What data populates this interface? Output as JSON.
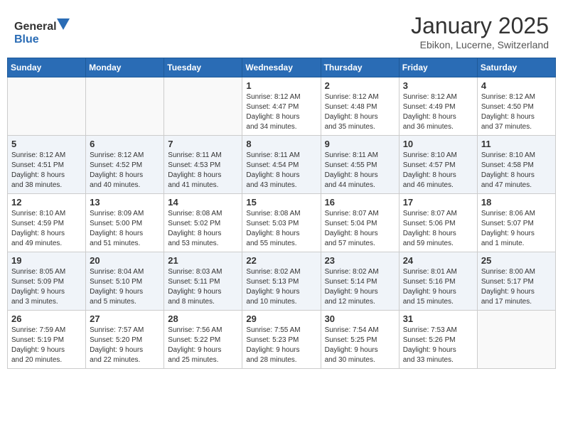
{
  "header": {
    "logo_general": "General",
    "logo_blue": "Blue",
    "month": "January 2025",
    "location": "Ebikon, Lucerne, Switzerland"
  },
  "days_of_week": [
    "Sunday",
    "Monday",
    "Tuesday",
    "Wednesday",
    "Thursday",
    "Friday",
    "Saturday"
  ],
  "weeks": [
    [
      {
        "day": "",
        "info": ""
      },
      {
        "day": "",
        "info": ""
      },
      {
        "day": "",
        "info": ""
      },
      {
        "day": "1",
        "info": "Sunrise: 8:12 AM\nSunset: 4:47 PM\nDaylight: 8 hours\nand 34 minutes."
      },
      {
        "day": "2",
        "info": "Sunrise: 8:12 AM\nSunset: 4:48 PM\nDaylight: 8 hours\nand 35 minutes."
      },
      {
        "day": "3",
        "info": "Sunrise: 8:12 AM\nSunset: 4:49 PM\nDaylight: 8 hours\nand 36 minutes."
      },
      {
        "day": "4",
        "info": "Sunrise: 8:12 AM\nSunset: 4:50 PM\nDaylight: 8 hours\nand 37 minutes."
      }
    ],
    [
      {
        "day": "5",
        "info": "Sunrise: 8:12 AM\nSunset: 4:51 PM\nDaylight: 8 hours\nand 38 minutes."
      },
      {
        "day": "6",
        "info": "Sunrise: 8:12 AM\nSunset: 4:52 PM\nDaylight: 8 hours\nand 40 minutes."
      },
      {
        "day": "7",
        "info": "Sunrise: 8:11 AM\nSunset: 4:53 PM\nDaylight: 8 hours\nand 41 minutes."
      },
      {
        "day": "8",
        "info": "Sunrise: 8:11 AM\nSunset: 4:54 PM\nDaylight: 8 hours\nand 43 minutes."
      },
      {
        "day": "9",
        "info": "Sunrise: 8:11 AM\nSunset: 4:55 PM\nDaylight: 8 hours\nand 44 minutes."
      },
      {
        "day": "10",
        "info": "Sunrise: 8:10 AM\nSunset: 4:57 PM\nDaylight: 8 hours\nand 46 minutes."
      },
      {
        "day": "11",
        "info": "Sunrise: 8:10 AM\nSunset: 4:58 PM\nDaylight: 8 hours\nand 47 minutes."
      }
    ],
    [
      {
        "day": "12",
        "info": "Sunrise: 8:10 AM\nSunset: 4:59 PM\nDaylight: 8 hours\nand 49 minutes."
      },
      {
        "day": "13",
        "info": "Sunrise: 8:09 AM\nSunset: 5:00 PM\nDaylight: 8 hours\nand 51 minutes."
      },
      {
        "day": "14",
        "info": "Sunrise: 8:08 AM\nSunset: 5:02 PM\nDaylight: 8 hours\nand 53 minutes."
      },
      {
        "day": "15",
        "info": "Sunrise: 8:08 AM\nSunset: 5:03 PM\nDaylight: 8 hours\nand 55 minutes."
      },
      {
        "day": "16",
        "info": "Sunrise: 8:07 AM\nSunset: 5:04 PM\nDaylight: 8 hours\nand 57 minutes."
      },
      {
        "day": "17",
        "info": "Sunrise: 8:07 AM\nSunset: 5:06 PM\nDaylight: 8 hours\nand 59 minutes."
      },
      {
        "day": "18",
        "info": "Sunrise: 8:06 AM\nSunset: 5:07 PM\nDaylight: 9 hours\nand 1 minute."
      }
    ],
    [
      {
        "day": "19",
        "info": "Sunrise: 8:05 AM\nSunset: 5:09 PM\nDaylight: 9 hours\nand 3 minutes."
      },
      {
        "day": "20",
        "info": "Sunrise: 8:04 AM\nSunset: 5:10 PM\nDaylight: 9 hours\nand 5 minutes."
      },
      {
        "day": "21",
        "info": "Sunrise: 8:03 AM\nSunset: 5:11 PM\nDaylight: 9 hours\nand 8 minutes."
      },
      {
        "day": "22",
        "info": "Sunrise: 8:02 AM\nSunset: 5:13 PM\nDaylight: 9 hours\nand 10 minutes."
      },
      {
        "day": "23",
        "info": "Sunrise: 8:02 AM\nSunset: 5:14 PM\nDaylight: 9 hours\nand 12 minutes."
      },
      {
        "day": "24",
        "info": "Sunrise: 8:01 AM\nSunset: 5:16 PM\nDaylight: 9 hours\nand 15 minutes."
      },
      {
        "day": "25",
        "info": "Sunrise: 8:00 AM\nSunset: 5:17 PM\nDaylight: 9 hours\nand 17 minutes."
      }
    ],
    [
      {
        "day": "26",
        "info": "Sunrise: 7:59 AM\nSunset: 5:19 PM\nDaylight: 9 hours\nand 20 minutes."
      },
      {
        "day": "27",
        "info": "Sunrise: 7:57 AM\nSunset: 5:20 PM\nDaylight: 9 hours\nand 22 minutes."
      },
      {
        "day": "28",
        "info": "Sunrise: 7:56 AM\nSunset: 5:22 PM\nDaylight: 9 hours\nand 25 minutes."
      },
      {
        "day": "29",
        "info": "Sunrise: 7:55 AM\nSunset: 5:23 PM\nDaylight: 9 hours\nand 28 minutes."
      },
      {
        "day": "30",
        "info": "Sunrise: 7:54 AM\nSunset: 5:25 PM\nDaylight: 9 hours\nand 30 minutes."
      },
      {
        "day": "31",
        "info": "Sunrise: 7:53 AM\nSunset: 5:26 PM\nDaylight: 9 hours\nand 33 minutes."
      },
      {
        "day": "",
        "info": ""
      }
    ]
  ]
}
